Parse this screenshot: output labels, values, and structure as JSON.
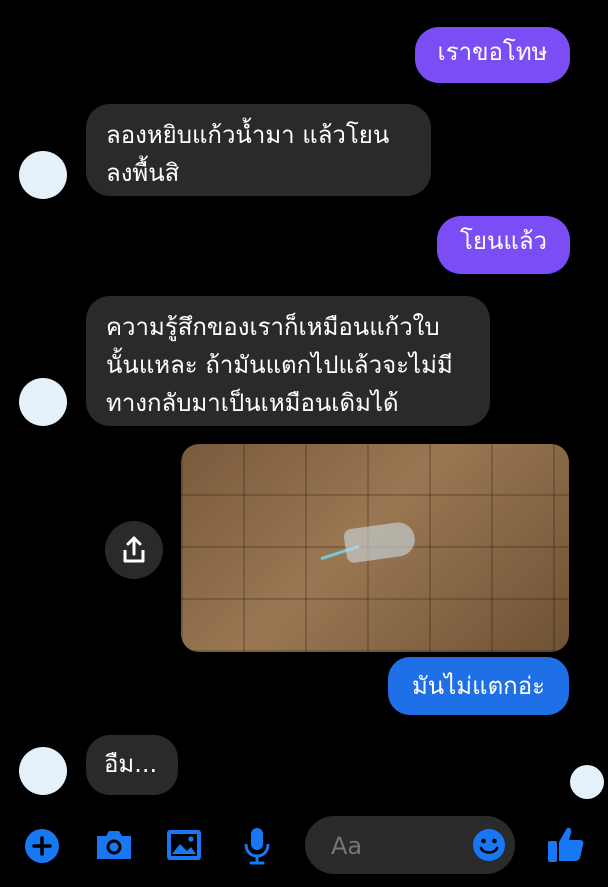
{
  "messages": {
    "m1": "เราขอโทษ",
    "m2_line1": "ลองหยิบแก้วน้ำมา แล้วโยน",
    "m2_line2": "ลงพื้นสิ",
    "m3": "โยนแล้ว",
    "m4_line1": "ความรู้สึกของเราก็เหมือนแก้วใบ",
    "m4_line2": "นั้นแหละ ถ้ามันแตกไปแล้วจะไม่มี",
    "m4_line3": "ทางกลับมาเป็นเหมือนเดิมได้",
    "m5": "มันไม่แตกอ่ะ",
    "m6": "อืม..."
  },
  "composer": {
    "placeholder": "Aa"
  },
  "colors": {
    "outgoing_purple": "#7b4ef5",
    "outgoing_blue": "#1f6fe6",
    "incoming": "#2a2a2c",
    "icon_blue": "#1877f2"
  },
  "icons": [
    "share-icon",
    "plus-icon",
    "camera-icon",
    "gallery-icon",
    "microphone-icon",
    "emoji-icon",
    "thumbs-up-icon"
  ]
}
